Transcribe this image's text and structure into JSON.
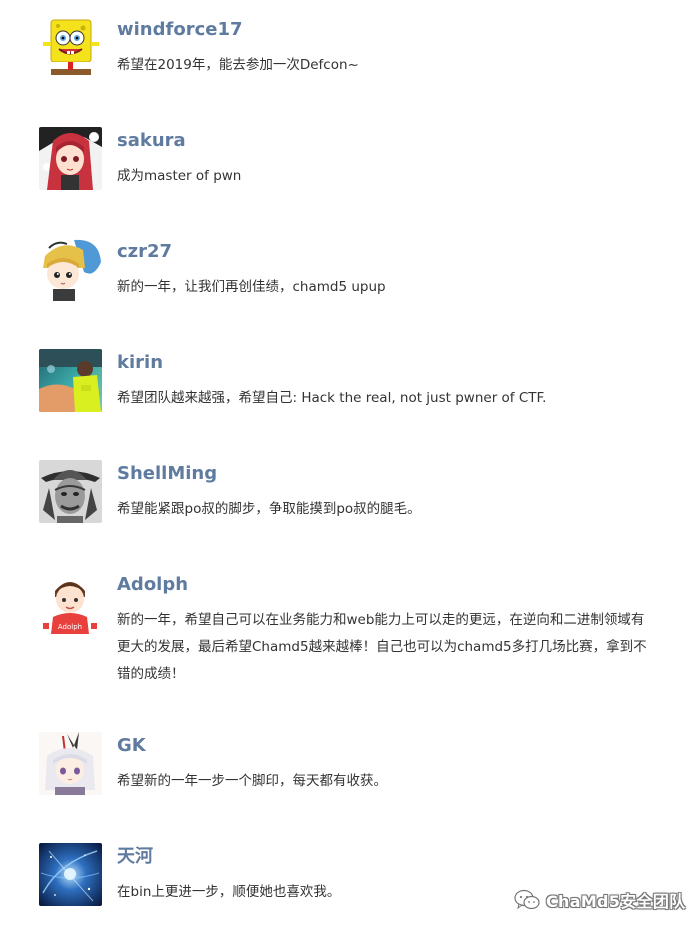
{
  "comments": [
    {
      "name": "windforce17",
      "text": "希望在2019年，能去参加一次Defcon~",
      "avatar_icon": "spongebob-avatar-icon"
    },
    {
      "name": "sakura",
      "text": "成为master of pwn",
      "avatar_icon": "anime-girl-red-hair-avatar-icon"
    },
    {
      "name": "czr27",
      "text": "新的一年，让我们再创佳绩，chamd5 upup",
      "avatar_icon": "anime-chibi-avatar-icon"
    },
    {
      "name": "kirin",
      "text": "希望团队越来越强，希望自己: Hack the real, not just pwner of CTF.",
      "avatar_icon": "photo-avatar-icon"
    },
    {
      "name": "ShellMing",
      "text": "希望能紧跟po叔的脚步，争取能摸到po叔的腿毛。",
      "avatar_icon": "man-with-hat-avatar-icon"
    },
    {
      "name": "Adolph",
      "text": "新的一年，希望自己可以在业务能力和web能力上可以走的更远，在逆向和二进制领域有更大的发展，最后希望Chamd5越来越棒！自己也可以为chamd5多打几场比赛，拿到不错的成绩！",
      "avatar_icon": "cartoon-boy-avatar-icon",
      "avatar_caption": "Adolph"
    },
    {
      "name": "GK",
      "text": "希望新的一年一步一个脚印，每天都有收获。",
      "avatar_icon": "anime-white-hair-avatar-icon"
    },
    {
      "name": "天河",
      "text": "在bin上更进一步，顺便她也喜欢我。",
      "avatar_icon": "blue-galaxy-avatar-icon"
    }
  ],
  "watermark": {
    "label": "ChaMd5安全团队",
    "icon": "wechat-icon"
  }
}
